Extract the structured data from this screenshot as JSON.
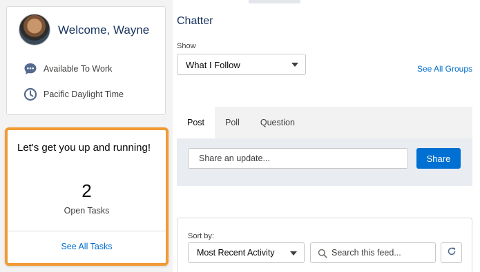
{
  "welcome": {
    "title": "Welcome, Wayne",
    "status": {
      "label": "Available To Work",
      "icon": "chat-bubble-icon"
    },
    "timezone": {
      "label": "Pacific Daylight Time",
      "icon": "clock-icon"
    }
  },
  "tasks": {
    "heading": "Let's get you up and running!",
    "count": "2",
    "count_label": "Open Tasks",
    "link": "See All Tasks",
    "highlight_color": "#f29a33"
  },
  "chatter": {
    "title": "Chatter",
    "show_label": "Show",
    "show_value": "What I Follow",
    "see_groups": "See All Groups"
  },
  "publisher": {
    "tabs": [
      {
        "label": "Post",
        "active": true
      },
      {
        "label": "Poll",
        "active": false
      },
      {
        "label": "Question",
        "active": false
      }
    ],
    "placeholder": "Share an update...",
    "share_label": "Share",
    "accent": "#0070d2"
  },
  "feed": {
    "sort_label": "Sort by:",
    "sort_value": "Most Recent Activity",
    "search_placeholder": "Search this feed...",
    "refresh_icon": "refresh-icon"
  }
}
